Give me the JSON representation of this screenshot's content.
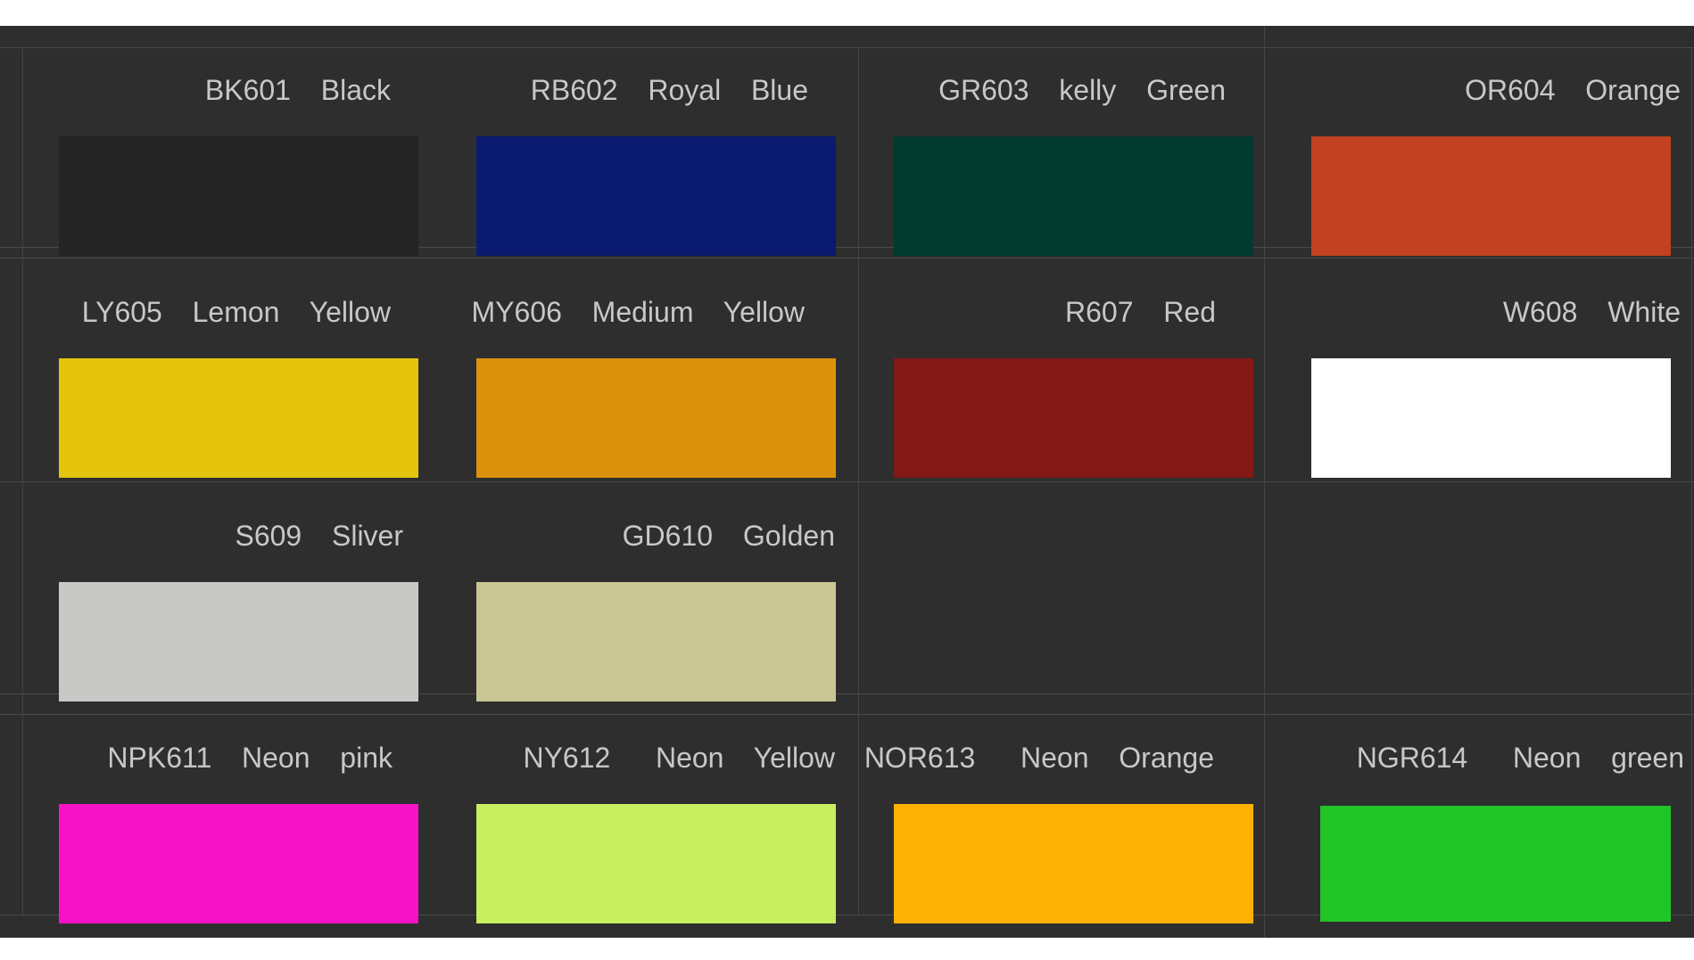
{
  "swatches": [
    {
      "label": "BK601  Black",
      "color": "#232423"
    },
    {
      "label": "RB602  Royal  Blue",
      "color": "#0a1a6e"
    },
    {
      "label": "GR603  kelly  Green",
      "color": "#013a2e"
    },
    {
      "label": "OR604  Orange",
      "color": "#c24120"
    },
    {
      "label": "LY605  Lemon  Yellow",
      "color": "#e4c40d"
    },
    {
      "label": "MY606  Medium  Yellow",
      "color": "#dc910b"
    },
    {
      "label": "R607  Red",
      "color": "#821917"
    },
    {
      "label": "W608  White",
      "color": "#ffffff"
    },
    {
      "label": "S609  Sliver",
      "color": "#c8c9c6"
    },
    {
      "label": "GD610  Golden",
      "color": "#c8c795"
    },
    {
      "label": "NPK611  Neon  pink",
      "color": "#f712c8"
    },
    {
      "label": "NY612   Neon  Yellow",
      "color": "#c7ef5f"
    },
    {
      "label": "NOR613   Neon  Orange",
      "color": "#fdb103"
    },
    {
      "label": "NGR614   Neon  green",
      "color": "#22c527"
    }
  ]
}
